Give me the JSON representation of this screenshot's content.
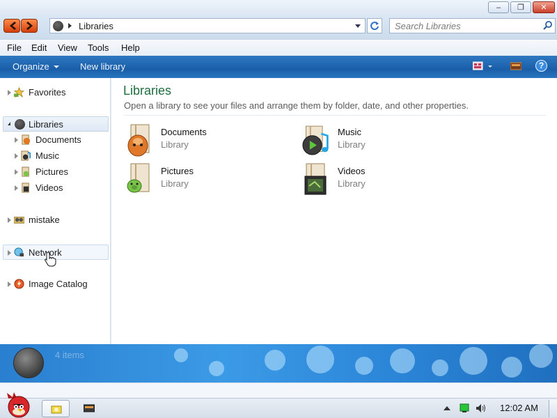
{
  "window": {
    "buttons": {
      "minimize_icon": "minimize-icon",
      "maximize_icon": "maximize-icon",
      "close_icon": "close-icon"
    }
  },
  "address_bar": {
    "path": "Libraries",
    "search_placeholder": "Search Libraries"
  },
  "menu": {
    "items": [
      "File",
      "Edit",
      "View",
      "Tools",
      "Help"
    ]
  },
  "command_bar": {
    "organize": "Organize",
    "new_library": "New library",
    "help_glyph": "?"
  },
  "nav": {
    "favorites": "Favorites",
    "libraries": "Libraries",
    "documents": "Documents",
    "music": "Music",
    "pictures": "Pictures",
    "videos": "Videos",
    "mistake": "mistake",
    "network": "Network",
    "image_catalog": "Image Catalog"
  },
  "content": {
    "title": "Libraries",
    "description": "Open a library to see your files and arrange them by folder, date, and other properties.",
    "libraries": [
      {
        "name": "Documents",
        "type": "Library"
      },
      {
        "name": "Music",
        "type": "Library"
      },
      {
        "name": "Pictures",
        "type": "Library"
      },
      {
        "name": "Videos",
        "type": "Library"
      }
    ]
  },
  "details": {
    "count": "4 items"
  },
  "taskbar": {
    "clock": "12:02 AM"
  },
  "colors": {
    "command_bar": "#1f63ad",
    "title_green": "#1e6e3e",
    "accent_orange": "#e0551c"
  }
}
